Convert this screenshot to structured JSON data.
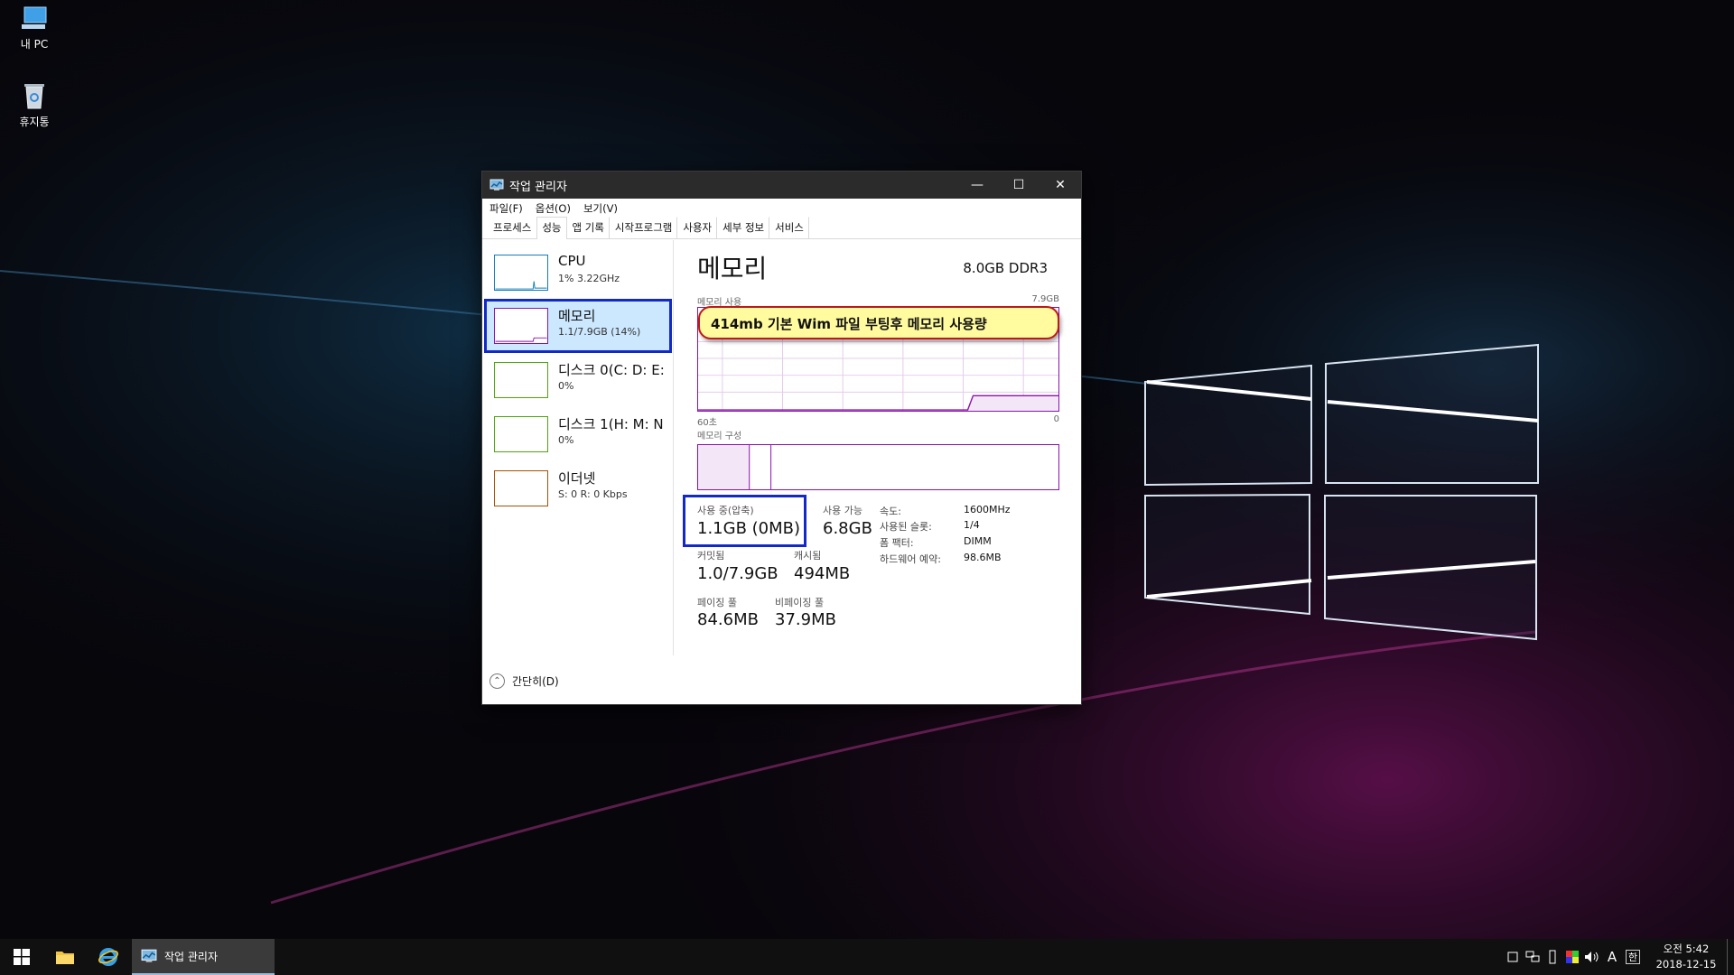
{
  "desktop": {
    "icons": [
      {
        "label": "내 PC",
        "icon": "computer-icon"
      },
      {
        "label": "휴지통",
        "icon": "recycle-bin-icon"
      }
    ]
  },
  "window": {
    "title": "작업 관리자",
    "controls": {
      "minimize": "—",
      "maximize": "☐",
      "close": "✕"
    },
    "menu": [
      "파일(F)",
      "옵션(O)",
      "보기(V)"
    ],
    "tabs": [
      "프로세스",
      "성능",
      "앱 기록",
      "시작프로그램",
      "사용자",
      "세부 정보",
      "서비스"
    ],
    "active_tab": "성능",
    "sidebar": [
      {
        "name": "CPU",
        "sub": "1% 3.22GHz",
        "color": "#117dbb"
      },
      {
        "name": "메모리",
        "sub": "1.1/7.9GB (14%)",
        "color": "#8b12ae",
        "selected": true
      },
      {
        "name": "디스크 0(C: D: E:",
        "sub": "0%",
        "color": "#4da60c"
      },
      {
        "name": "디스크 1(H: M: N",
        "sub": "0%",
        "color": "#4da60c"
      },
      {
        "name": "이더넷",
        "sub": "S: 0 R: 0 Kbps",
        "color": "#a74f01"
      }
    ],
    "memory": {
      "title": "메모리",
      "spec": "8.0GB DDR3",
      "usage_label": "메모리 사용",
      "usage_max": "7.9GB",
      "time_left": "60초",
      "time_right": "0",
      "composition_label": "메모리 구성",
      "stats": {
        "in_use_label": "사용 중(압축)",
        "in_use_value": "1.1GB (0MB)",
        "available_label": "사용 가능",
        "available_value": "6.8GB",
        "committed_label": "커밋됨",
        "committed_value": "1.0/7.9GB",
        "cached_label": "캐시됨",
        "cached_value": "494MB",
        "paged_label": "페이징 풀",
        "paged_value": "84.6MB",
        "nonpaged_label": "비페이징 풀",
        "nonpaged_value": "37.9MB"
      },
      "details": [
        {
          "label": "속도:",
          "value": "1600MHz"
        },
        {
          "label": "사용된 슬롯:",
          "value": "1/4"
        },
        {
          "label": "폼 팩터:",
          "value": "DIMM"
        },
        {
          "label": "하드웨어 예약:",
          "value": "98.6MB"
        }
      ]
    },
    "fewer_details": "간단히(D)"
  },
  "annotation": {
    "text": "414mb 기본 Wim 파일 부팅후 메모리 사용량"
  },
  "taskbar": {
    "running_app": "작업 관리자",
    "ime": "A",
    "ime2": "한",
    "clock_time": "오전 5:42",
    "clock_date": "2018-12-15"
  },
  "colors": {
    "memory_accent": "#8b12ae",
    "highlight_border": "#1229c8",
    "callout_fill": "#fffb9e",
    "callout_border": "#c01818"
  }
}
